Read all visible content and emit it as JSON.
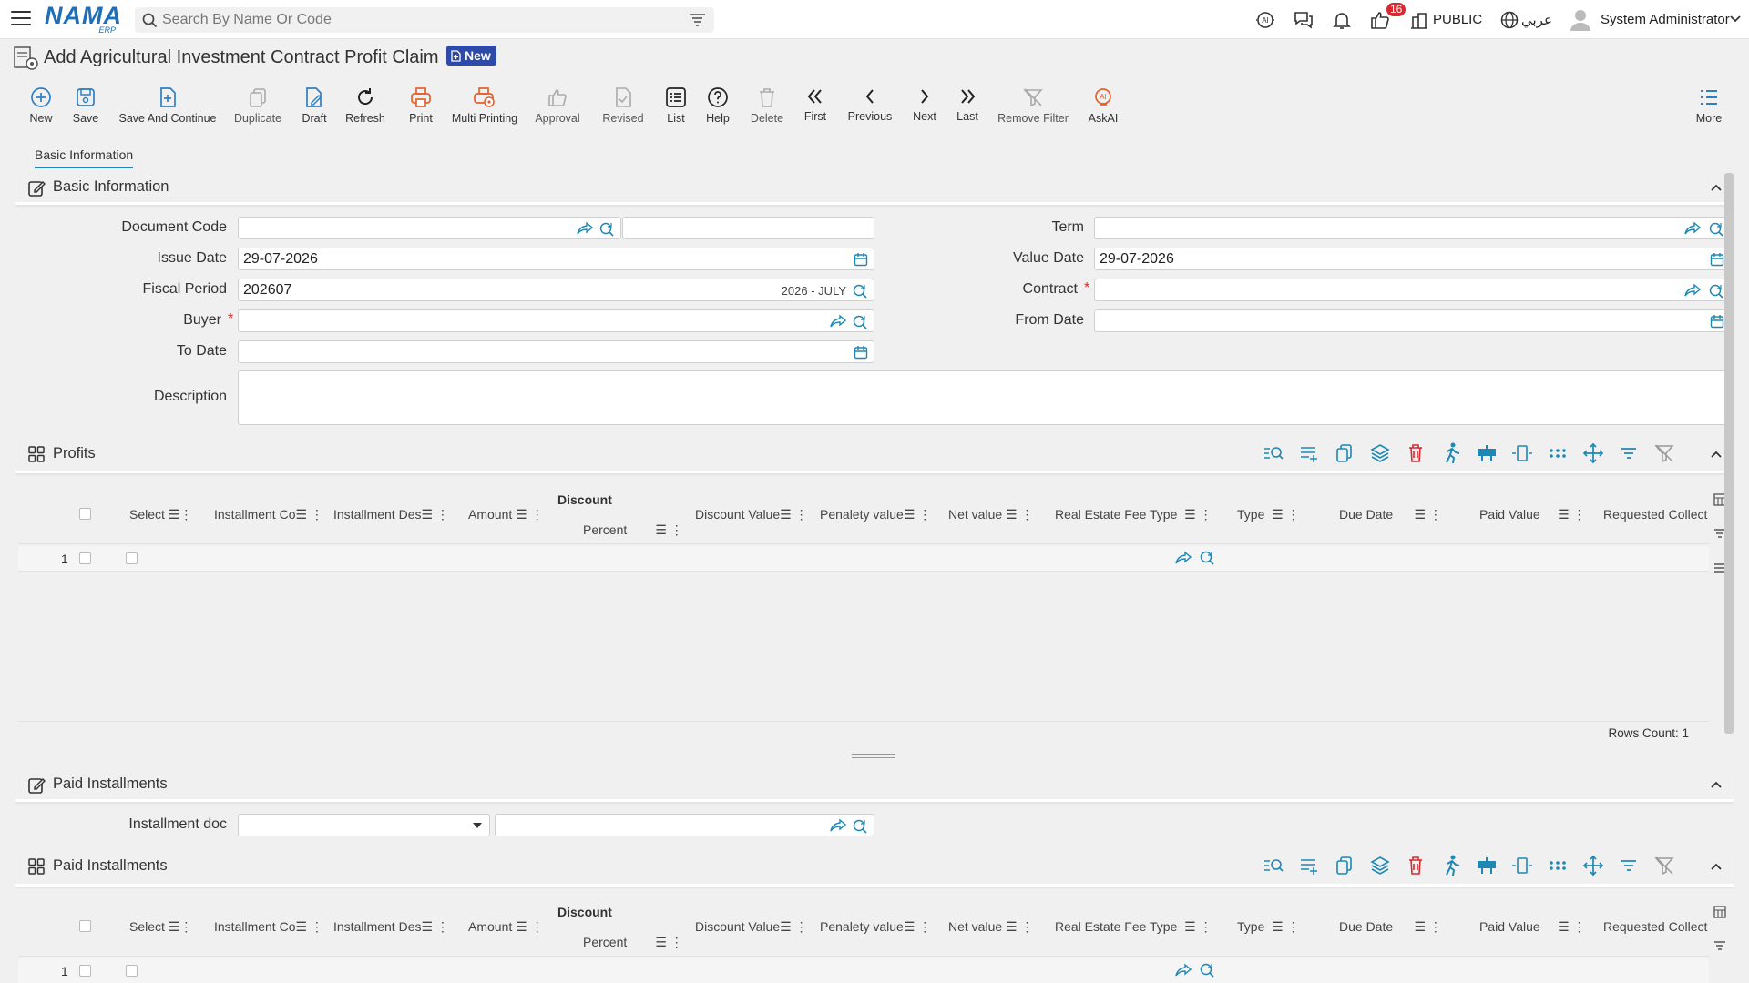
{
  "topbar": {
    "logo_main": "NAMA",
    "logo_sub": "ERP",
    "search_placeholder": "Search By Name Or Code",
    "notification_count": "16",
    "public_label": "PUBLIC",
    "language_label": "عربي",
    "user_name": "System Administrator"
  },
  "title": {
    "text": "Add Agricultural Investment Contract Profit Claim",
    "badge": "New"
  },
  "toolbar": {
    "items": [
      {
        "label": "New",
        "icon": "plus-circle-icon"
      },
      {
        "label": "Save",
        "icon": "save-icon"
      },
      {
        "label": "Save And Continue",
        "icon": "save-continue-icon"
      },
      {
        "label": "Duplicate",
        "icon": "duplicate-icon"
      },
      {
        "label": "Draft",
        "icon": "draft-icon"
      },
      {
        "label": "Refresh",
        "icon": "refresh-icon"
      },
      {
        "label": "Print",
        "icon": "print-icon"
      },
      {
        "label": "Multi Printing",
        "icon": "multi-print-icon"
      },
      {
        "label": "Approval",
        "icon": "thumbs-up-icon"
      },
      {
        "label": "Revised",
        "icon": "revised-icon"
      },
      {
        "label": "List",
        "icon": "list-icon"
      },
      {
        "label": "Help",
        "icon": "help-icon"
      },
      {
        "label": "Delete",
        "icon": "trash-icon"
      },
      {
        "label": "First",
        "icon": "double-chevron-left-icon"
      },
      {
        "label": "Previous",
        "icon": "chevron-left-icon"
      },
      {
        "label": "Next",
        "icon": "chevron-right-icon"
      },
      {
        "label": "Last",
        "icon": "double-chevron-right-icon"
      },
      {
        "label": "Remove Filter",
        "icon": "remove-filter-icon"
      },
      {
        "label": "AskAI",
        "icon": "ai-icon"
      }
    ],
    "more_label": "More"
  },
  "tabs": {
    "basic": "Basic Information"
  },
  "basic_section": {
    "title": "Basic Information",
    "fields": {
      "document_code": {
        "label": "Document Code",
        "value": ""
      },
      "issue_date": {
        "label": "Issue Date",
        "value": "29-07-2026"
      },
      "fiscal_period": {
        "label": "Fiscal Period",
        "value": "202607",
        "extra": "2026 - JULY"
      },
      "buyer": {
        "label": "Buyer",
        "value": ""
      },
      "to_date": {
        "label": "To Date",
        "value": ""
      },
      "description": {
        "label": "Description",
        "value": ""
      },
      "term": {
        "label": "Term",
        "value": ""
      },
      "value_date": {
        "label": "Value Date",
        "value": "29-07-2026"
      },
      "contract": {
        "label": "Contract",
        "value": ""
      },
      "from_date": {
        "label": "From Date",
        "value": ""
      }
    }
  },
  "profits_section": {
    "title": "Profits",
    "columns": {
      "select": "Select",
      "installment_code": "Installment Co",
      "installment_desc": "Installment Des",
      "amount": "Amount",
      "discount": "Discount",
      "percent": "Percent",
      "discount_value": "Discount Value",
      "penalty_value": "Penalety value",
      "net_value": "Net value",
      "real_estate_fee_type": "Real Estate Fee Type",
      "type": "Type",
      "due_date": "Due Date",
      "paid_value": "Paid Value",
      "requested_collection": "Requested Collect"
    },
    "row_number": "1",
    "rows_count": "Rows Count: 1"
  },
  "paid_section": {
    "title": "Paid Installments",
    "installment_doc_label": "Installment doc",
    "grid_title": "Paid Installments",
    "row_number": "1"
  }
}
